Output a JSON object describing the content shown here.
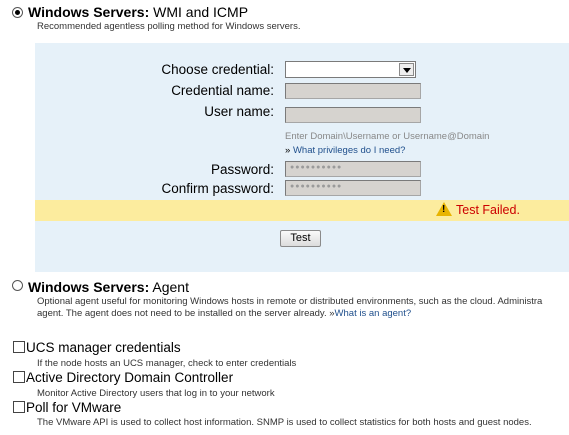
{
  "wmi_option": {
    "title_bold": "Windows Servers:",
    "title_rest": " WMI and ICMP",
    "description": "Recommended agentless polling method for Windows servers.",
    "selected": true
  },
  "credentials_form": {
    "choose_credential_label": "Choose credential:",
    "choose_credential_value": "",
    "credential_name_label": "Credential name:",
    "user_name_label": "User name:",
    "user_name_hint": "Enter Domain\\Username or Username@Domain",
    "privileges_link": "What privileges do I need?",
    "link_bullet": "»",
    "password_label": "Password:",
    "confirm_password_label": "Confirm password:",
    "error_message": "Test Failed.",
    "test_button": "Test"
  },
  "agent_option": {
    "title_bold": "Windows Servers:",
    "title_rest": " Agent",
    "description_line1": "Optional agent useful for monitoring Windows hosts in remote or distributed environments, such as the cloud. Administra",
    "description_line2": "agent. The agent does not need to be installed on the server already.",
    "link_bullet": "»",
    "agent_link": "What is an agent?",
    "selected": false
  },
  "checkboxes": [
    {
      "title": "UCS manager credentials",
      "description": "If the node hosts an UCS manager, check to enter credentials",
      "checked": false
    },
    {
      "title": "Active Directory Domain Controller",
      "description": "Monitor Active Directory users that log in to your network",
      "checked": false
    },
    {
      "title": "Poll for VMware",
      "description": "The VMware API is used to collect host information. SNMP is used to collect statistics for both hosts and guest nodes.",
      "checked": false
    }
  ],
  "colors": {
    "panel_bg": "#e6f1f9",
    "error_bar_bg": "#fcec9e",
    "error_text": "#cc0000",
    "link": "#1f4f8c"
  }
}
